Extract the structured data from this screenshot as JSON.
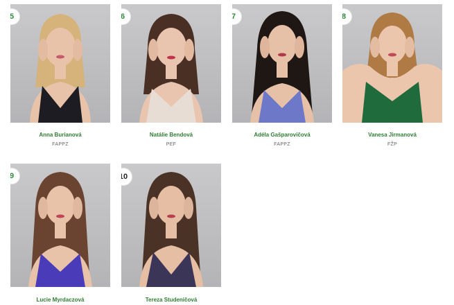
{
  "contestants": [
    {
      "number": "5",
      "name": "Anna Burianová",
      "faculty": "FAPPZ",
      "hair": "#d6b37a",
      "dress": "#1c1c22",
      "skin": "#e8c3aa"
    },
    {
      "number": "6",
      "name": "Natálie Bendová",
      "faculty": "PEF",
      "hair": "#4a3024",
      "dress": "#e8ddd4",
      "skin": "#e9c4ae"
    },
    {
      "number": "7",
      "name": "Adéla Gašparovičová",
      "faculty": "FAPPZ",
      "hair": "#1e1714",
      "dress": "#6d78c8",
      "skin": "#e6c0a7"
    },
    {
      "number": "8",
      "name": "Vanesa Jirmanová",
      "faculty": "FŽP",
      "hair": "#b07a45",
      "dress": "#1f6b3c",
      "skin": "#ebc6ad"
    },
    {
      "number": "9",
      "name": "Lucie Myrdaczová",
      "faculty": "",
      "hair": "#6a4430",
      "dress": "#4a3cb8",
      "skin": "#e9c2aa"
    },
    {
      "number": "10",
      "name": "Tereza Studeničová",
      "faculty": "",
      "hair": "#4a3326",
      "dress": "#3b3658",
      "skin": "#e6bea4"
    }
  ]
}
